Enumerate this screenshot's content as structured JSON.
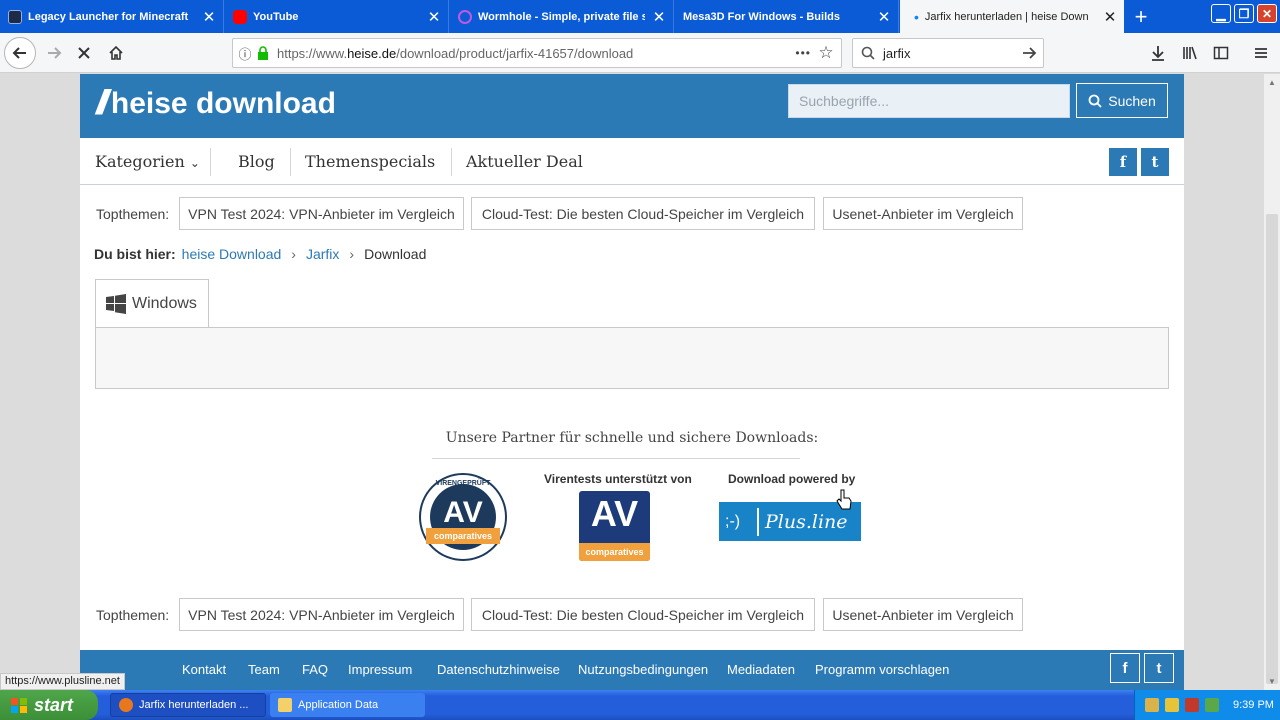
{
  "browser": {
    "tabs": [
      {
        "label": "Legacy Launcher for Minecraft",
        "icon": "legacy-launcher-icon",
        "color": "#1e2b46"
      },
      {
        "label": "YouTube",
        "icon": "youtube-icon",
        "color": "#ff0000"
      },
      {
        "label": "Wormhole - Simple, private file sha",
        "icon": "wormhole-icon",
        "color": "#9c27b0"
      },
      {
        "label": "Mesa3D For Windows - Builds",
        "icon": "mesa-icon",
        "color": "#3a7ae0"
      },
      {
        "label": "Jarfix herunterladen | heise Down",
        "icon": "loading-dot-icon",
        "color": "#0a84ff",
        "active": true
      }
    ],
    "new_tab": "+",
    "url_prefix": "https://www.",
    "url_host": "heise.de",
    "url_path": "/download/product/jarfix-41657/download",
    "page_actions": "•••",
    "search_value": "jarfix"
  },
  "site": {
    "logo_text": "heise download",
    "search_placeholder": "Suchbegriffe...",
    "search_button": "Suchen",
    "menu": [
      "Kategorien",
      "Blog",
      "Themenspecials",
      "Aktueller Deal"
    ],
    "social": {
      "facebook": "f",
      "twitter": "t"
    },
    "topthemen_label": "Topthemen:",
    "topthemen": [
      "VPN Test 2024: VPN-Anbieter im Vergleich",
      "Cloud-Test: Die besten Cloud-Speicher im Vergleich",
      "Usenet-Anbieter im Vergleich"
    ],
    "breadcrumb": {
      "label": "Du bist hier:",
      "items": [
        "heise Download",
        "Jarfix",
        "Download"
      ],
      "separator": "›"
    },
    "os_tab": "Windows",
    "partners": {
      "heading": "Unsere Partner für schnelle und sichere Downloads:",
      "virus_label": "Virentests unterstützt von",
      "download_label": "Download powered by",
      "seal_top": "VIRENGEPRÜFT",
      "seal_av": "AV",
      "seal_bottom": "comparatives",
      "av_text": "AV",
      "av_sub": "comparatives",
      "plusline_smiley": ";-)",
      "plusline_text": "Plus.line"
    },
    "footer_links": [
      "Kontakt",
      "Team",
      "FAQ",
      "Impressum",
      "Datenschutzhinweise",
      "Nutzungsbedingungen",
      "Mediadaten",
      "Programm vorschlagen"
    ]
  },
  "status_url": "https://www.plusline.net",
  "taskbar": {
    "start": "start",
    "buttons": [
      {
        "label": "Jarfix herunterladen ...",
        "icon": "firefox-icon"
      },
      {
        "label": "Application Data",
        "icon": "folder-icon"
      }
    ],
    "clock": "9:39 PM"
  },
  "colors": {
    "brand_blue": "#2c7ab5",
    "tabstrip_blue": "#0c5bd6",
    "taskbar_blue": "#245edb",
    "start_green": "#3c8f38"
  }
}
